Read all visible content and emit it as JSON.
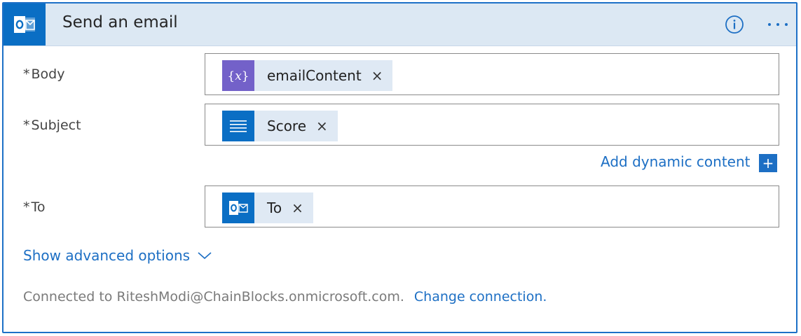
{
  "header": {
    "title": "Send an email",
    "logo_icon": "outlook-icon",
    "info_icon": "info-icon",
    "more_icon": "more-options-icon"
  },
  "fields": {
    "body": {
      "required_marker": "*",
      "label": "Body",
      "token_label": "emailContent",
      "token_icon": "variable-icon",
      "token_remove": "×"
    },
    "subject": {
      "required_marker": "*",
      "label": "Subject",
      "token_label": "Score",
      "token_icon": "text-lines-icon",
      "token_remove": "×"
    },
    "to": {
      "required_marker": "*",
      "label": "To",
      "token_label": "To",
      "token_icon": "outlook-icon",
      "token_remove": "×"
    }
  },
  "dynamic": {
    "label": "Add dynamic content",
    "plus": "+"
  },
  "advanced": {
    "label": "Show advanced options"
  },
  "footer": {
    "connected_text": "Connected to RiteshModi@ChainBlocks.onmicrosoft.com.",
    "change_link": "Change connection."
  },
  "colors": {
    "accent": "#1d6fc4",
    "header_bg": "#dce8f3",
    "token_bg": "#dfe9f4",
    "variable_token": "#7361c9",
    "outlook_blue": "#0a6ec4"
  }
}
